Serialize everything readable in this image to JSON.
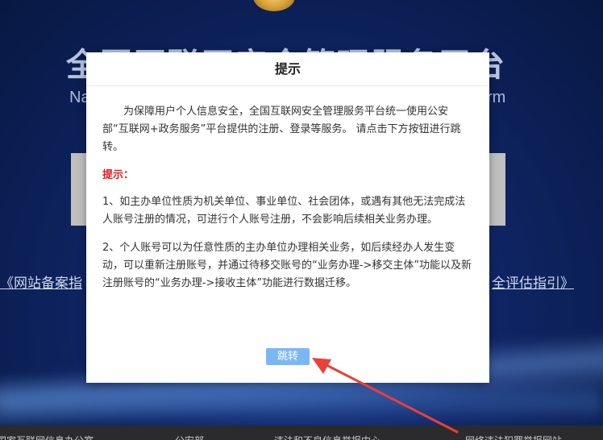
{
  "background": {
    "title": "全国互联网安全管理服务平台",
    "subtitle_left": "Na",
    "subtitle_right": "rm",
    "link_left": "《网站备案指",
    "link_right": "全评估指引》",
    "footer_items": [
      "国家互联网信息办公室",
      "公安部",
      "违法和不良信息举报中心",
      "网络违法犯罪举报网站"
    ]
  },
  "modal": {
    "title": "提示",
    "intro": "为保障用户个人信息安全，全国互联网安全管理服务平台统一使用公安部“互联网+政务服务”平台提供的注册、登录等服务。 请点击下方按钮进行跳转。",
    "notice_label": "提示：",
    "notice_1": "1、如主办单位性质为机关单位、事业单位、社会团体，或遇有其他无法完成法人账号注册的情况，可进行个人账号注册，不会影响后续相关业务办理。",
    "notice_2": "2、个人账号可以为任意性质的主办单位办理相关业务，如后续经办人发生变动，可以重新注册账号，并通过待移交账号的“业务办理->移交主体”功能以及新注册账号的“业务办理->接收主体”功能进行数据迁移。",
    "button_label": "跳转"
  },
  "colors": {
    "button": "#7cb7f5",
    "notice_label": "#e02020",
    "arrow": "#e8403a"
  },
  "icons": {
    "arrow": "red-arrow-pointing-to-button"
  }
}
